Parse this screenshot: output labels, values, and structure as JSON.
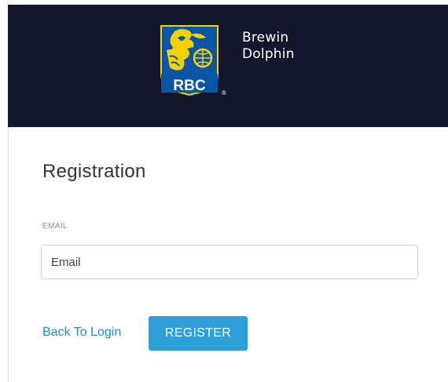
{
  "header": {
    "logo_text": "RBC",
    "brand_line1": "Brewin",
    "brand_line2": "Dolphin",
    "colors": {
      "background": "#13172c",
      "shield_blue": "#0b56a4",
      "shield_gold": "#f5d100"
    }
  },
  "form": {
    "title": "Registration",
    "email_label": "EMAIL",
    "email_placeholder": "Email",
    "email_value": ""
  },
  "actions": {
    "back_label": "Back To Login",
    "register_label": "REGISTER",
    "accent_color": "#2d9fd9"
  }
}
